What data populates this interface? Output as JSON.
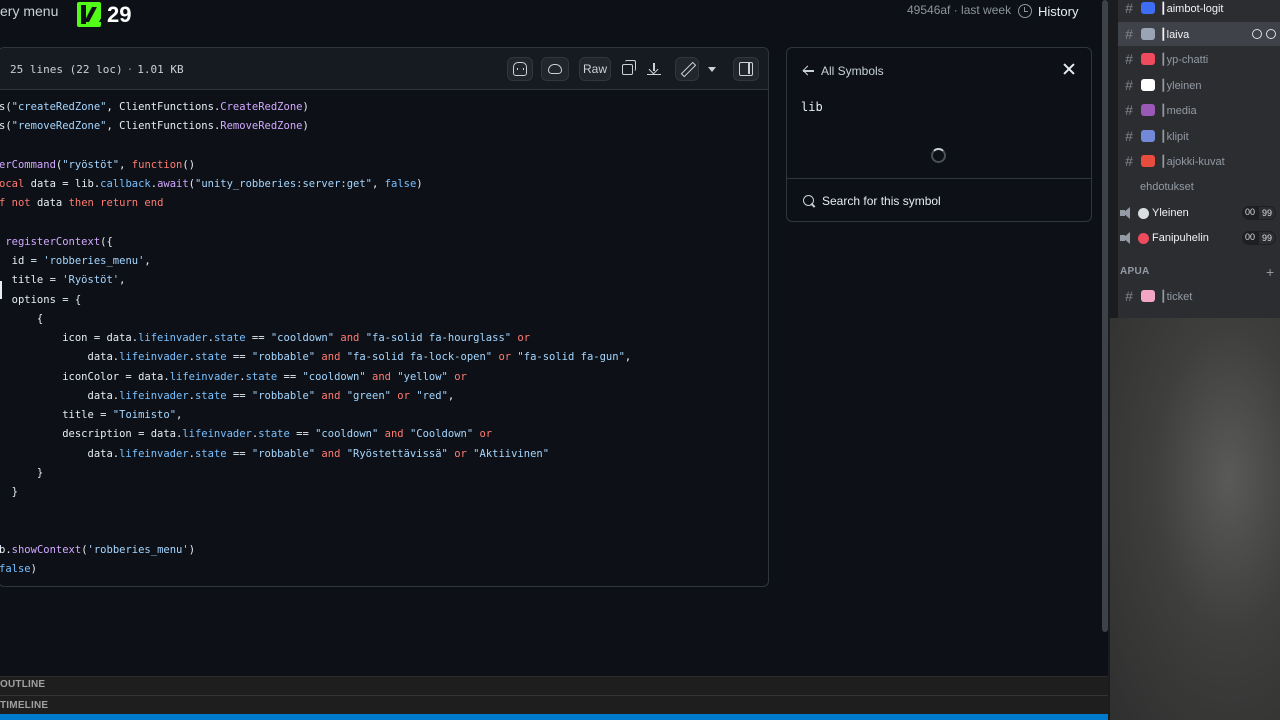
{
  "topbar": {
    "menu_title": "ery menu",
    "kick_count": "29",
    "commit": "49546af · last week",
    "history_label": "History"
  },
  "file": {
    "lines": "25 lines (22 loc)",
    "size": "1.01 KB",
    "raw_label": "Raw"
  },
  "code_lines": [
    [
      {
        "t": "s(",
        "c": ""
      },
      {
        "t": "\"createRedZone\"",
        "c": "s"
      },
      {
        "t": ", ClientFunctions.",
        "c": ""
      },
      {
        "t": "CreateRedZone",
        "c": "f"
      },
      {
        "t": ")",
        "c": ""
      }
    ],
    [
      {
        "t": "s(",
        "c": ""
      },
      {
        "t": "\"removeRedZone\"",
        "c": "s"
      },
      {
        "t": ", ClientFunctions.",
        "c": ""
      },
      {
        "t": "RemoveRedZone",
        "c": "f"
      },
      {
        "t": ")",
        "c": ""
      }
    ],
    [
      {
        "t": "",
        "c": ""
      }
    ],
    [
      {
        "t": "erCommand",
        "c": "f"
      },
      {
        "t": "(",
        "c": ""
      },
      {
        "t": "\"ryöstöt\"",
        "c": "s"
      },
      {
        "t": ", ",
        "c": ""
      },
      {
        "t": "function",
        "c": "k"
      },
      {
        "t": "()",
        "c": ""
      }
    ],
    [
      {
        "t": "ocal",
        "c": "k"
      },
      {
        "t": " data = lib.",
        "c": ""
      },
      {
        "t": "callback",
        "c": "c"
      },
      {
        "t": ".",
        "c": ""
      },
      {
        "t": "await",
        "c": "f"
      },
      {
        "t": "(",
        "c": ""
      },
      {
        "t": "\"unity_robberies:server:get\"",
        "c": "s"
      },
      {
        "t": ", ",
        "c": ""
      },
      {
        "t": "false",
        "c": "c"
      },
      {
        "t": ")",
        "c": ""
      }
    ],
    [
      {
        "t": "f ",
        "c": "k"
      },
      {
        "t": "not",
        "c": "k"
      },
      {
        "t": " data ",
        "c": ""
      },
      {
        "t": "then return end",
        "c": "k"
      }
    ],
    [
      {
        "t": "",
        "c": ""
      }
    ],
    [
      {
        "t": " ",
        "c": ""
      },
      {
        "t": "registerContext",
        "c": "f"
      },
      {
        "t": "({",
        "c": ""
      }
    ],
    [
      {
        "t": "  id = ",
        "c": ""
      },
      {
        "t": "'robberies_menu'",
        "c": "s"
      },
      {
        "t": ",",
        "c": ""
      }
    ],
    [
      {
        "t": "  title = ",
        "c": ""
      },
      {
        "t": "'Ryöstöt'",
        "c": "s"
      },
      {
        "t": ",",
        "c": ""
      }
    ],
    [
      {
        "t": "  options = {",
        "c": ""
      }
    ],
    [
      {
        "t": "      {",
        "c": ""
      }
    ],
    [
      {
        "t": "          icon = data.",
        "c": ""
      },
      {
        "t": "lifeinvader",
        "c": "c"
      },
      {
        "t": ".",
        "c": ""
      },
      {
        "t": "state",
        "c": "c"
      },
      {
        "t": " == ",
        "c": ""
      },
      {
        "t": "\"cooldown\"",
        "c": "s"
      },
      {
        "t": " and ",
        "c": "k"
      },
      {
        "t": "\"fa-solid fa-hourglass\"",
        "c": "s"
      },
      {
        "t": " or",
        "c": "k"
      }
    ],
    [
      {
        "t": "              data.",
        "c": ""
      },
      {
        "t": "lifeinvader",
        "c": "c"
      },
      {
        "t": ".",
        "c": ""
      },
      {
        "t": "state",
        "c": "c"
      },
      {
        "t": " == ",
        "c": ""
      },
      {
        "t": "\"robbable\"",
        "c": "s"
      },
      {
        "t": " and ",
        "c": "k"
      },
      {
        "t": "\"fa-solid fa-lock-open\"",
        "c": "s"
      },
      {
        "t": " or ",
        "c": "k"
      },
      {
        "t": "\"fa-solid fa-gun\"",
        "c": "s"
      },
      {
        "t": ",",
        "c": ""
      }
    ],
    [
      {
        "t": "          iconColor = data.",
        "c": ""
      },
      {
        "t": "lifeinvader",
        "c": "c"
      },
      {
        "t": ".",
        "c": ""
      },
      {
        "t": "state",
        "c": "c"
      },
      {
        "t": " == ",
        "c": ""
      },
      {
        "t": "\"cooldown\"",
        "c": "s"
      },
      {
        "t": " and ",
        "c": "k"
      },
      {
        "t": "\"yellow\"",
        "c": "s"
      },
      {
        "t": " or",
        "c": "k"
      }
    ],
    [
      {
        "t": "              data.",
        "c": ""
      },
      {
        "t": "lifeinvader",
        "c": "c"
      },
      {
        "t": ".",
        "c": ""
      },
      {
        "t": "state",
        "c": "c"
      },
      {
        "t": " == ",
        "c": ""
      },
      {
        "t": "\"robbable\"",
        "c": "s"
      },
      {
        "t": " and ",
        "c": "k"
      },
      {
        "t": "\"green\"",
        "c": "s"
      },
      {
        "t": " or ",
        "c": "k"
      },
      {
        "t": "\"red\"",
        "c": "s"
      },
      {
        "t": ",",
        "c": ""
      }
    ],
    [
      {
        "t": "          title = ",
        "c": ""
      },
      {
        "t": "\"Toimisto\"",
        "c": "s"
      },
      {
        "t": ",",
        "c": ""
      }
    ],
    [
      {
        "t": "          description = data.",
        "c": ""
      },
      {
        "t": "lifeinvader",
        "c": "c"
      },
      {
        "t": ".",
        "c": ""
      },
      {
        "t": "state",
        "c": "c"
      },
      {
        "t": " == ",
        "c": ""
      },
      {
        "t": "\"cooldown\"",
        "c": "s"
      },
      {
        "t": " and ",
        "c": "k"
      },
      {
        "t": "\"Cooldown\"",
        "c": "s"
      },
      {
        "t": " or",
        "c": "k"
      }
    ],
    [
      {
        "t": "              data.",
        "c": ""
      },
      {
        "t": "lifeinvader",
        "c": "c"
      },
      {
        "t": ".",
        "c": ""
      },
      {
        "t": "state",
        "c": "c"
      },
      {
        "t": " == ",
        "c": ""
      },
      {
        "t": "\"robbable\"",
        "c": "s"
      },
      {
        "t": " and ",
        "c": "k"
      },
      {
        "t": "\"Ryöstettävissä\"",
        "c": "s"
      },
      {
        "t": " or ",
        "c": "k"
      },
      {
        "t": "\"Aktiivinen\"",
        "c": "s"
      }
    ],
    [
      {
        "t": "      }",
        "c": ""
      }
    ],
    [
      {
        "t": "  }",
        "c": ""
      }
    ],
    [
      {
        "t": "",
        "c": ""
      }
    ],
    [
      {
        "t": "",
        "c": ""
      }
    ],
    [
      {
        "t": "b.",
        "c": ""
      },
      {
        "t": "showContext",
        "c": "f"
      },
      {
        "t": "(",
        "c": ""
      },
      {
        "t": "'robberies_menu'",
        "c": "s"
      },
      {
        "t": ")",
        "c": ""
      }
    ],
    [
      {
        "t": "false",
        "c": "c"
      },
      {
        "t": ")",
        "c": ""
      }
    ]
  ],
  "symbols": {
    "back_label": "All Symbols",
    "symbol_name": "lib",
    "search_label": "Search for this symbol"
  },
  "bottom": {
    "outline_label": "OUTLINE",
    "timeline_label": "TIMELINE"
  },
  "discord": {
    "channels": [
      {
        "name": "┃aimbot-logit",
        "icon": "hash",
        "emoji_color": "#3d6df2"
      },
      {
        "name": "┃laiva",
        "icon": "hash",
        "emoji_color": "#9aa4b5",
        "active": true
      },
      {
        "name": "┃yp-chatti",
        "icon": "hash",
        "emoji_color": "#f04a5e"
      },
      {
        "name": "┃yleinen",
        "icon": "hash",
        "emoji_color": "#ffffff"
      },
      {
        "name": "┃media",
        "icon": "hash",
        "emoji_color": "#9b59b6"
      },
      {
        "name": "┃klipit",
        "icon": "hash",
        "emoji_color": "#7289da"
      },
      {
        "name": "┃ajokki-kuvat",
        "icon": "hash",
        "emoji_color": "#e74c3c"
      },
      {
        "name": "ehdotukset",
        "icon": "none",
        "emoji_color": ""
      },
      {
        "name": "Yleinen",
        "icon": "voice",
        "emoji_color": "#dbdee1",
        "badge_left": "00",
        "badge_right": "99"
      },
      {
        "name": "Fanipuhelin",
        "icon": "voice",
        "emoji_color": "#f04a5e",
        "badge_left": "00",
        "badge_right": "99"
      }
    ],
    "category": "APUA",
    "category_channel": {
      "name": "┃ticket",
      "emoji_color": "#f2a6c3"
    }
  },
  "colors": {
    "accent": "#53fc18",
    "status_bar": "#007acc"
  }
}
